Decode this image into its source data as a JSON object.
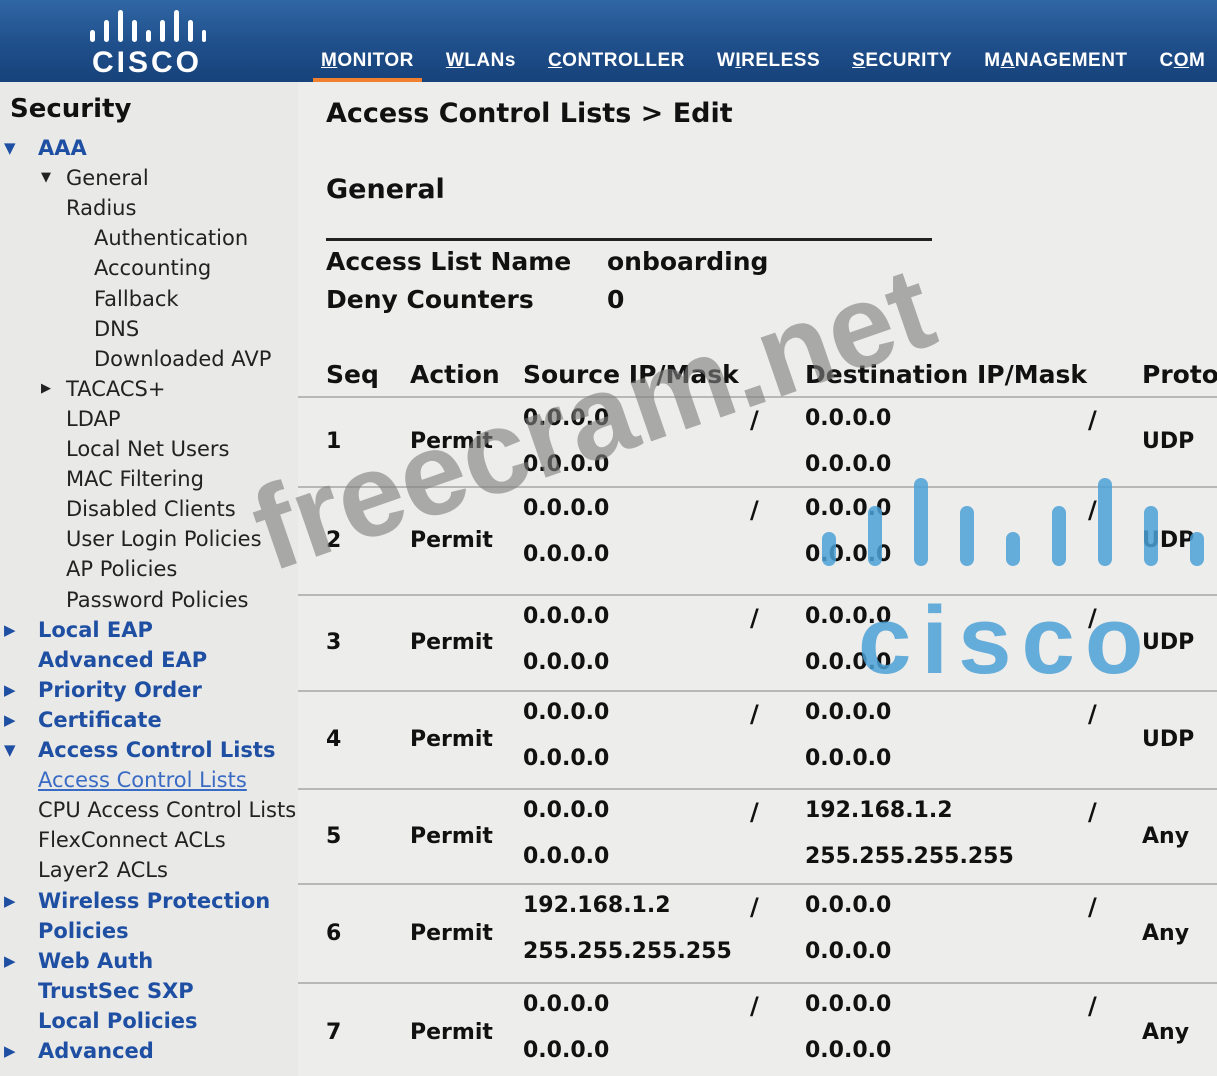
{
  "brand": {
    "logo_text": "CISCO",
    "color": "#1f4f8b",
    "accent": "#f08030",
    "link_color": "#1e4fa3"
  },
  "tabs": [
    {
      "pre": "",
      "ul": "M",
      "post": "ONITOR"
    },
    {
      "pre": "",
      "ul": "W",
      "post": "LANs"
    },
    {
      "pre": "",
      "ul": "C",
      "post": "ONTROLLER"
    },
    {
      "pre": "W",
      "ul": "I",
      "post": "RELESS"
    },
    {
      "pre": "",
      "ul": "S",
      "post": "ECURITY"
    },
    {
      "pre": "M",
      "ul": "A",
      "post": "NAGEMENT"
    },
    {
      "pre": "C",
      "ul": "O",
      "post": "M"
    }
  ],
  "sidebar": {
    "title": "Security",
    "items": [
      {
        "label": "AAA",
        "kind": "top",
        "arrow": "down"
      },
      {
        "label": "General",
        "kind": "sub",
        "arrow": "down"
      },
      {
        "label": "Radius",
        "kind": "sub",
        "arrow": ""
      },
      {
        "label": "Authentication",
        "kind": "sub",
        "arrow": ""
      },
      {
        "label": "Accounting",
        "kind": "sub",
        "arrow": ""
      },
      {
        "label": "Fallback",
        "kind": "sub",
        "arrow": ""
      },
      {
        "label": "DNS",
        "kind": "sub",
        "arrow": ""
      },
      {
        "label": "Downloaded AVP",
        "kind": "sub",
        "arrow": ""
      },
      {
        "label": "TACACS+",
        "kind": "sub",
        "arrow": "right"
      },
      {
        "label": "LDAP",
        "kind": "sub",
        "arrow": ""
      },
      {
        "label": "Local Net Users",
        "kind": "sub",
        "arrow": ""
      },
      {
        "label": "MAC Filtering",
        "kind": "sub",
        "arrow": ""
      },
      {
        "label": "Disabled Clients",
        "kind": "sub",
        "arrow": ""
      },
      {
        "label": "User Login Policies",
        "kind": "sub",
        "arrow": ""
      },
      {
        "label": "AP Policies",
        "kind": "sub",
        "arrow": ""
      },
      {
        "label": "Password Policies",
        "kind": "sub",
        "arrow": ""
      },
      {
        "label": "Local EAP",
        "kind": "top",
        "arrow": "right"
      },
      {
        "label": "Advanced EAP",
        "kind": "top",
        "arrow": ""
      },
      {
        "label": "Priority Order",
        "kind": "top",
        "arrow": "right"
      },
      {
        "label": "Certificate",
        "kind": "top",
        "arrow": "right"
      },
      {
        "label": "Access Control Lists",
        "kind": "top",
        "arrow": "down"
      },
      {
        "label": "Access Control Lists",
        "kind": "active",
        "arrow": ""
      },
      {
        "label": "CPU Access Control Lists",
        "kind": "sub",
        "arrow": ""
      },
      {
        "label": "FlexConnect ACLs",
        "kind": "sub",
        "arrow": ""
      },
      {
        "label": "Layer2 ACLs",
        "kind": "sub",
        "arrow": ""
      },
      {
        "label": "Wireless Protection",
        "kind": "top",
        "arrow": "right"
      },
      {
        "label": "Policies",
        "kind": "top",
        "arrow": ""
      },
      {
        "label": "Web Auth",
        "kind": "top",
        "arrow": "right"
      },
      {
        "label": "TrustSec SXP",
        "kind": "top",
        "arrow": ""
      },
      {
        "label": "Local Policies",
        "kind": "top",
        "arrow": ""
      },
      {
        "label": "Advanced",
        "kind": "top",
        "arrow": "right"
      }
    ]
  },
  "page": {
    "title": "Access Control Lists > Edit",
    "section": "General",
    "fields": [
      {
        "label": "Access List Name",
        "value": "onboarding"
      },
      {
        "label": "Deny Counters",
        "value": "0"
      }
    ]
  },
  "table": {
    "columns": [
      "Seq",
      "Action",
      "Source IP/Mask",
      "Destination IP/Mask",
      "Protoc"
    ],
    "separator": "/",
    "rows": [
      {
        "seq": "1",
        "action": "Permit",
        "src_ip": "0.0.0.0",
        "src_mask": "0.0.0.0",
        "dst_ip": "0.0.0.0",
        "dst_mask": "0.0.0.0",
        "protocol": "UDP"
      },
      {
        "seq": "2",
        "action": "Permit",
        "src_ip": "0.0.0.0",
        "src_mask": "0.0.0.0",
        "dst_ip": "0.0.0.0",
        "dst_mask": "0.0.0.0",
        "protocol": "UDP"
      },
      {
        "seq": "3",
        "action": "Permit",
        "src_ip": "0.0.0.0",
        "src_mask": "0.0.0.0",
        "dst_ip": "0.0.0.0",
        "dst_mask": "0.0.0.0",
        "protocol": "UDP"
      },
      {
        "seq": "4",
        "action": "Permit",
        "src_ip": "0.0.0.0",
        "src_mask": "0.0.0.0",
        "dst_ip": "0.0.0.0",
        "dst_mask": "0.0.0.0",
        "protocol": "UDP"
      },
      {
        "seq": "5",
        "action": "Permit",
        "src_ip": "0.0.0.0",
        "src_mask": "0.0.0.0",
        "dst_ip": "192.168.1.2",
        "dst_mask": "255.255.255.255",
        "protocol": "Any"
      },
      {
        "seq": "6",
        "action": "Permit",
        "src_ip": "192.168.1.2",
        "src_mask": "255.255.255.255",
        "dst_ip": "0.0.0.0",
        "dst_mask": "0.0.0.0",
        "protocol": "Any"
      },
      {
        "seq": "7",
        "action": "Permit",
        "src_ip": "0.0.0.0",
        "src_mask": "0.0.0.0",
        "dst_ip": "0.0.0.0",
        "dst_mask": "0.0.0.0",
        "protocol": "Any"
      }
    ]
  },
  "watermarks": {
    "text": "freecram.net",
    "logo_text": "cisco"
  }
}
